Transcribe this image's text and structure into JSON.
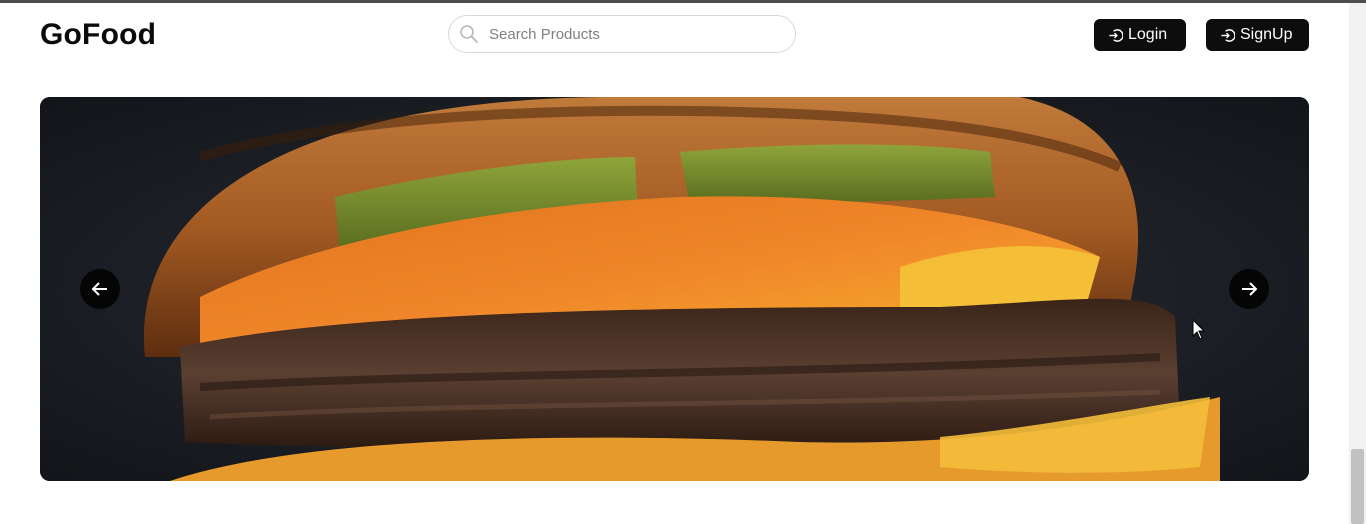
{
  "app": {
    "brand": "GoFood"
  },
  "search": {
    "placeholder": "Search Products"
  },
  "nav": {
    "login_label": "Login",
    "signup_label": "SignUp"
  },
  "carousel": {
    "slide_image": "burger-closeup-photo",
    "prev_icon": "arrow-left-icon",
    "next_icon": "arrow-right-icon"
  },
  "colors": {
    "button_bg": "#0d0d0d",
    "button_text": "#ffffff",
    "arrow_bg": "#050505"
  }
}
